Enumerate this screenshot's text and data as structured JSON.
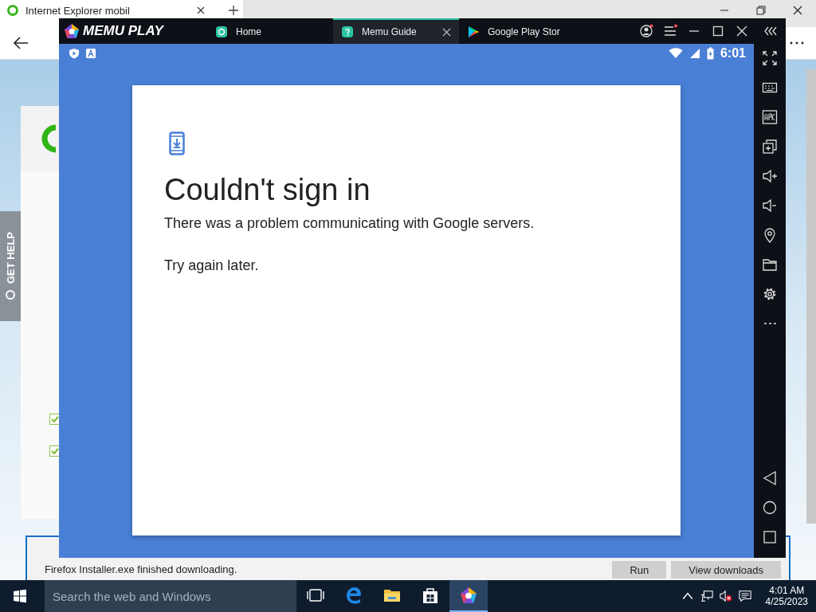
{
  "browser": {
    "tab_title": "Internet Explorer mobil",
    "help_tab": "GET HELP",
    "checklist": [
      {
        "checked": true
      },
      {
        "checked": true
      }
    ],
    "download_bar": {
      "message": "Firefox Installer.exe finished downloading.",
      "buttons": [
        "Run",
        "View downloads"
      ]
    }
  },
  "emulator": {
    "logo": "MEMU PLAY",
    "tabs": [
      {
        "label": "Home",
        "kind": "home",
        "selected": false
      },
      {
        "label": "Memu Guide",
        "kind": "guide",
        "selected": true
      },
      {
        "label": "Google Play Stor",
        "kind": "play",
        "selected": false
      }
    ],
    "status_bar": {
      "time": "6:01"
    },
    "dialog": {
      "title": "Couldn't sign in",
      "message": "There was a problem communicating with Google servers.",
      "hint": "Try again later."
    }
  },
  "taskbar": {
    "search_placeholder": "Search the web and Windows",
    "apps": [
      {
        "kind": "task-view",
        "selected": false
      },
      {
        "kind": "edge",
        "selected": false
      },
      {
        "kind": "folder",
        "selected": false
      },
      {
        "kind": "store",
        "selected": false
      },
      {
        "kind": "memu",
        "selected": true
      }
    ],
    "time": "4:01 AM",
    "date": "4/25/2023"
  }
}
